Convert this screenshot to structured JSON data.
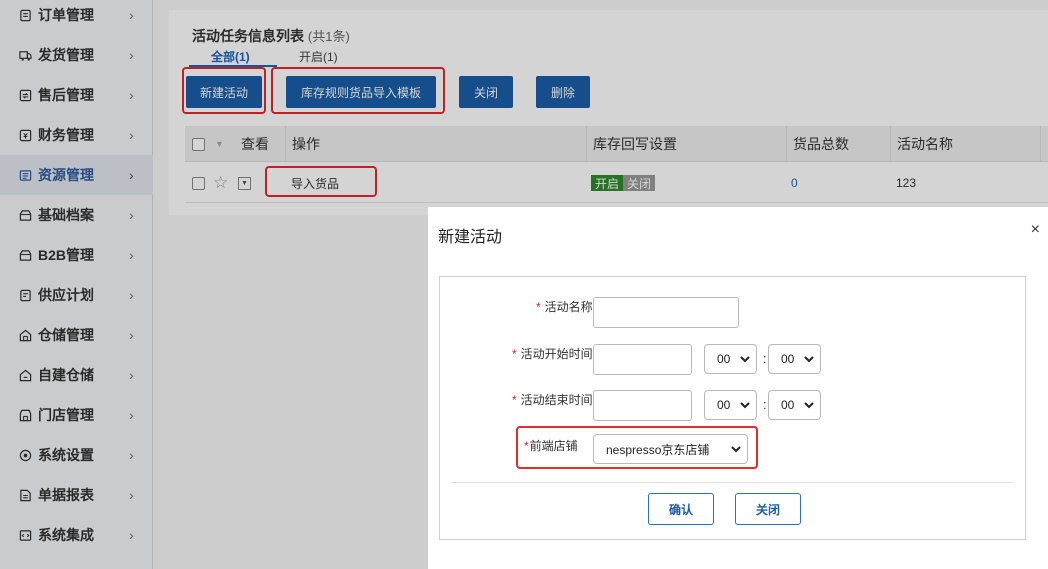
{
  "sidebar": {
    "items": [
      {
        "label": "订单管理",
        "icon": "order-icon"
      },
      {
        "label": "发货管理",
        "icon": "truck-icon"
      },
      {
        "label": "售后管理",
        "icon": "after-sale-icon"
      },
      {
        "label": "财务管理",
        "icon": "finance-icon"
      },
      {
        "label": "资源管理",
        "icon": "resource-icon",
        "active": true
      },
      {
        "label": "基础档案",
        "icon": "archive-icon"
      },
      {
        "label": "B2B管理",
        "icon": "b2b-icon"
      },
      {
        "label": "供应计划",
        "icon": "supply-plan-icon"
      },
      {
        "label": "仓储管理",
        "icon": "warehouse-icon"
      },
      {
        "label": "自建仓储",
        "icon": "self-warehouse-icon"
      },
      {
        "label": "门店管理",
        "icon": "store-icon"
      },
      {
        "label": "系统设置",
        "icon": "settings-icon"
      },
      {
        "label": "单据报表",
        "icon": "report-icon"
      },
      {
        "label": "系统集成",
        "icon": "integration-icon"
      }
    ],
    "chevron": "›"
  },
  "list": {
    "title": "活动任务信息列表",
    "count": "(共1条)",
    "tabs": [
      {
        "label": "全部(1)",
        "active": true
      },
      {
        "label": "开启(1)"
      }
    ],
    "toolbar": {
      "new": "新建活动",
      "import_template": "库存规则货品导入模板",
      "close": "关闭",
      "delete": "删除"
    },
    "columns": [
      "查看",
      "操作",
      "库存回写设置",
      "货品总数",
      "活动名称"
    ],
    "rows": [
      {
        "action": "导入货品",
        "toggle_on": "开启",
        "toggle_off": "关闭",
        "total": "0",
        "name": "123"
      }
    ]
  },
  "modal": {
    "title": "新建活动",
    "close_glyph": "×",
    "required_mark": "*",
    "fields": {
      "name_label": "活动名称:",
      "start_label": "活动开始时间:",
      "end_label": "活动结束时间:",
      "shop_label": "前端店铺",
      "hour": "00",
      "minute": "00",
      "colon": ":",
      "shop_value": "nespresso京东店铺"
    },
    "confirm": "确认",
    "cancel": "关闭"
  },
  "colors": {
    "primary": "#1a5ea8",
    "highlight": "#e52b2b",
    "toggle_on": "#2e8b2e",
    "required": "#e02020"
  }
}
